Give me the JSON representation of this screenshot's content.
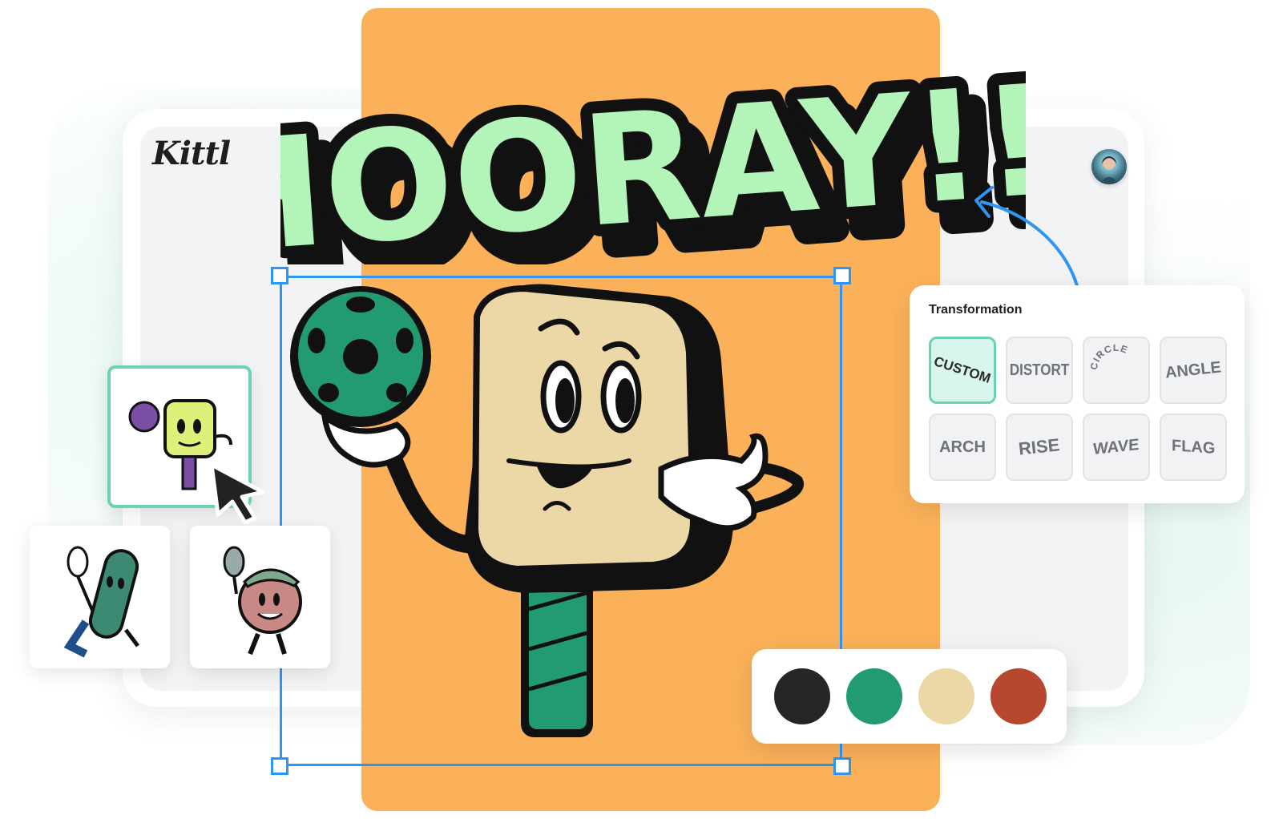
{
  "app": {
    "logo": "Kittl",
    "avatar_label": "user-avatar"
  },
  "headline": {
    "text": "HOORAY!!!",
    "fill_color": "#b3f4b8",
    "outline_color": "#111111"
  },
  "canvas": {
    "background_color": "#fbb159"
  },
  "selection": {
    "color": "#2f95f2"
  },
  "transformation_panel": {
    "title": "Transformation",
    "options": [
      {
        "label": "CUSTOM",
        "active": true
      },
      {
        "label": "DISTORT",
        "active": false
      },
      {
        "label": "CIRCLE",
        "active": false
      },
      {
        "label": "ANGLE",
        "active": false
      },
      {
        "label": "ARCH",
        "active": false
      },
      {
        "label": "RISE",
        "active": false
      },
      {
        "label": "WAVE",
        "active": false
      },
      {
        "label": "FLAG",
        "active": false
      }
    ]
  },
  "palette": {
    "colors": [
      "#262626",
      "#239b70",
      "#ecd7a6",
      "#b7482f"
    ]
  },
  "thumbnails": [
    {
      "name": "paddle-character",
      "selected": true
    },
    {
      "name": "pickle-character",
      "selected": false
    },
    {
      "name": "ball-character",
      "selected": false
    }
  ]
}
